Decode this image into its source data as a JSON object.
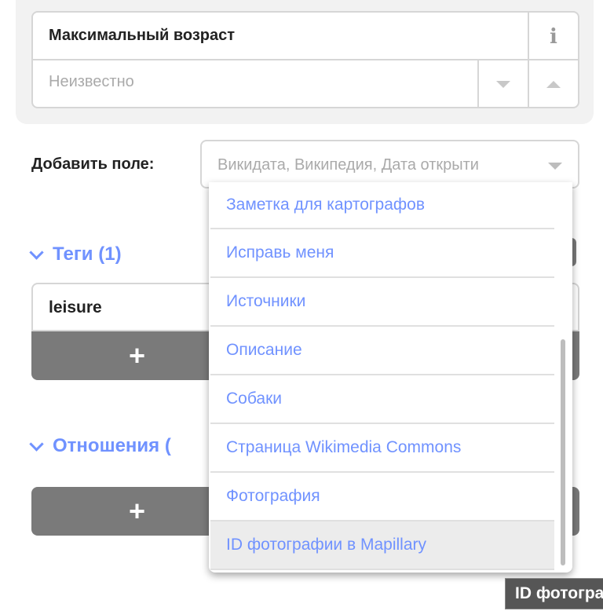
{
  "field": {
    "label": "Максимальный возраст",
    "info_icon": "i",
    "placeholder": "Неизвестно"
  },
  "add_field": {
    "label": "Добавить поле:",
    "placeholder": "Википедия, Дата открыти",
    "placeholder_full": "Викидата, Википедия, Дата открыти"
  },
  "tags": {
    "header": "Теги (1)",
    "rows": [
      {
        "key": "leisure"
      }
    ],
    "add_label": "+"
  },
  "relations": {
    "header": "Отношения (",
    "add_label": "+"
  },
  "dropdown": {
    "items": [
      "Заметка для картографов",
      "Исправь меня",
      "Источники",
      "Описание",
      "Собаки",
      "Страница Wikimedia Commons",
      "Фотография",
      "ID фотографии в Mapillary"
    ],
    "hovered_index": 7
  },
  "tooltip": {
    "text": "ID фотогра"
  },
  "colors": {
    "accent": "#7092ff",
    "button_bg": "#7a7a7a",
    "border": "#d6d6d6"
  }
}
